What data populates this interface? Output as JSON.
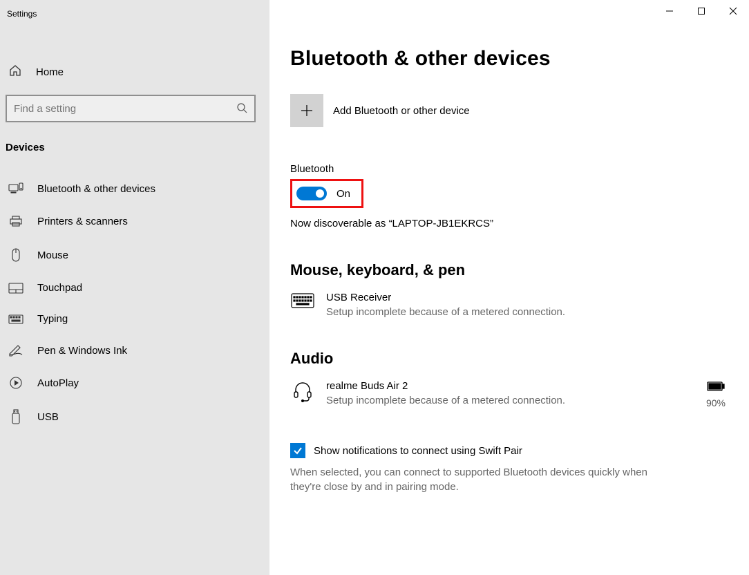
{
  "window": {
    "title": "Settings"
  },
  "sidebar": {
    "home": "Home",
    "search_placeholder": "Find a setting",
    "section": "Devices",
    "items": [
      {
        "icon": "bluetooth-devices-icon",
        "label": "Bluetooth & other devices"
      },
      {
        "icon": "printer-icon",
        "label": "Printers & scanners"
      },
      {
        "icon": "mouse-icon",
        "label": "Mouse"
      },
      {
        "icon": "touchpad-icon",
        "label": "Touchpad"
      },
      {
        "icon": "typing-icon",
        "label": "Typing"
      },
      {
        "icon": "pen-icon",
        "label": "Pen & Windows Ink"
      },
      {
        "icon": "autoplay-icon",
        "label": "AutoPlay"
      },
      {
        "icon": "usb-icon",
        "label": "USB"
      }
    ]
  },
  "main": {
    "title": "Bluetooth & other devices",
    "add_device": "Add Bluetooth or other device",
    "bluetooth_label": "Bluetooth",
    "toggle_state": "On",
    "discoverable": "Now discoverable as “LAPTOP-JB1EKRCS”",
    "section_mkbp": "Mouse, keyboard, & pen",
    "device_usb": {
      "name": "USB Receiver",
      "sub": "Setup incomplete because of a metered connection."
    },
    "section_audio": "Audio",
    "device_audio": {
      "name": "realme Buds Air 2",
      "sub": "Setup incomplete because of a metered connection.",
      "battery": "90%"
    },
    "swiftpair_label": "Show notifications to connect using Swift Pair",
    "swiftpair_desc": "When selected, you can connect to supported Bluetooth devices quickly when they're close by and in pairing mode."
  }
}
